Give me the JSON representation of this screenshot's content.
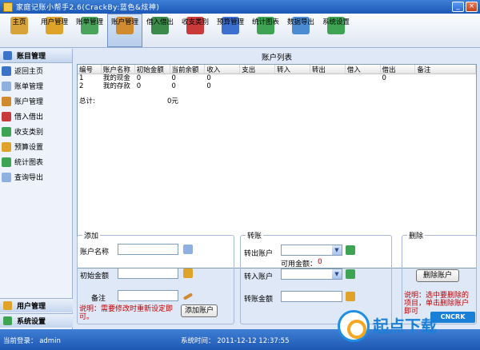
{
  "window": {
    "title": "家庭记账小帮手2.6(CrackBy:蓝色&炫神)"
  },
  "toolbar": {
    "items": [
      {
        "label": "主页",
        "icon": "house-icon",
        "color": "#d9a33c"
      },
      {
        "label": "用户管理",
        "icon": "user-icon",
        "color": "#e0a32a"
      },
      {
        "label": "账单管理",
        "icon": "bill-icon",
        "color": "#4aa35b"
      },
      {
        "label": "账户管理",
        "icon": "pencil-icon",
        "color": "#d08a2f"
      },
      {
        "label": "借入借出",
        "icon": "exchange-icon",
        "color": "#3c8a4a"
      },
      {
        "label": "收支类别",
        "icon": "category-icon",
        "color": "#c93a3a"
      },
      {
        "label": "预算管理",
        "icon": "budget-icon",
        "color": "#3c6fcf"
      },
      {
        "label": "统计图表",
        "icon": "chart-icon",
        "color": "#3ea352"
      },
      {
        "label": "数据导出",
        "icon": "export-icon",
        "color": "#4b8bd1"
      },
      {
        "label": "系统设置",
        "icon": "settings-icon",
        "color": "#3ea352"
      }
    ],
    "active_index": 3
  },
  "sidebar": {
    "header": "账目管理",
    "items": [
      {
        "label": "返回主页",
        "icon": "back-icon",
        "color": "#3a73c8"
      },
      {
        "label": "账单管理",
        "icon": "bill-icon",
        "color": "#8fb1df"
      },
      {
        "label": "账户管理",
        "icon": "pencil-icon",
        "color": "#d08a2f"
      },
      {
        "label": "借入借出",
        "icon": "exchange-icon",
        "color": "#c93a3a"
      },
      {
        "label": "收支类别",
        "icon": "category-icon",
        "color": "#3ea352"
      },
      {
        "label": "预算设置",
        "icon": "budget-icon",
        "color": "#e0a32a"
      },
      {
        "label": "统计图表",
        "icon": "chart-icon",
        "color": "#3ea352"
      },
      {
        "label": "查询导出",
        "icon": "export-icon",
        "color": "#8fb1df"
      }
    ],
    "bottom": [
      "用户管理",
      "系统设置"
    ]
  },
  "main": {
    "list_title": "账户列表",
    "columns": [
      "编号",
      "账户名称",
      "初始金额",
      "当前余额",
      "收入",
      "支出",
      "转入",
      "转出",
      "借入",
      "借出",
      "备注"
    ],
    "rows": [
      [
        "1",
        "我的现金",
        "0",
        "0",
        "0",
        "",
        "",
        "",
        "",
        "0",
        ""
      ],
      [
        "2",
        "我的存款",
        "0",
        "0",
        "0",
        "",
        "",
        "",
        "",
        "",
        ""
      ]
    ],
    "total": {
      "label": "总计:",
      "value": "0元"
    }
  },
  "add": {
    "legend": "添加",
    "name_label": "账户名称",
    "initial_label": "初始金额",
    "note_label": "备注",
    "note_text": "说明：需要修改时重新设定即可。",
    "button": "添加账户"
  },
  "transfer": {
    "legend": "转账",
    "out_label": "转出账户",
    "available_label": "可用金额：",
    "available_value": "0",
    "in_label": "转入账户",
    "amount_label": "转账金额"
  },
  "delete": {
    "legend": "删除",
    "button": "删除账户",
    "note": "说明：选中要删除的项目，单击删除账户即可"
  },
  "statusbar": {
    "login": "当前登录：  admin",
    "time": "系统时间：  2011-12-12 12:37:55"
  },
  "watermark": {
    "text": "起点下载",
    "badge": "CNCRK"
  }
}
